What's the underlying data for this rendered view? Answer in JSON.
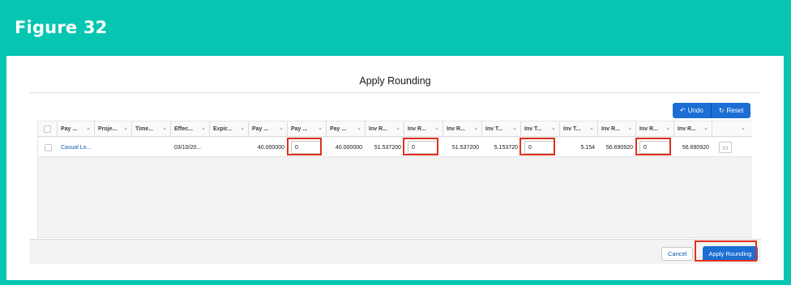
{
  "figure": {
    "title": "Figure 32"
  },
  "modal": {
    "title": "Apply Rounding"
  },
  "toolbar": {
    "undo_label": "Undo",
    "undo_icon": "undo-icon",
    "reset_label": "Reset",
    "reset_icon": "reset-icon"
  },
  "table": {
    "headers": [
      "Pay ...",
      "Proje...",
      "Time...",
      "Effec...",
      "Expir...",
      "Pay ...",
      "Pay ...",
      "Pay ...",
      "Inv R...",
      "Inv R...",
      "Inv R...",
      "Inv T...",
      "Inv T...",
      "Inv T...",
      "Inv R...",
      "Inv R...",
      "Inv R..."
    ],
    "row": {
      "pay_name": "Casual Lo...",
      "project": "",
      "time": "",
      "effective": "03/10/20...",
      "expiry": "",
      "pay_rate": "40.000000",
      "pay_rounding_input": "0",
      "pay_rounded": "40.000000",
      "inv_rate": "51.537200",
      "inv_rounding_input": "0",
      "inv_rounded": "51.537200",
      "inv_tax": "5.153720",
      "inv_tax_rounding_input": "0",
      "inv_tax_rounded": "5.154",
      "inv_rate2": "56.690920",
      "inv_rate2_rounding_input": "0",
      "inv_rate2_rounded": "56.690920"
    }
  },
  "footer": {
    "cancel_label": "Cancel",
    "apply_label": "Apply Rounding"
  },
  "colors": {
    "brand_teal": "#06c6b1",
    "primary_blue": "#1b6ed4",
    "highlight_red": "#e0311f"
  }
}
